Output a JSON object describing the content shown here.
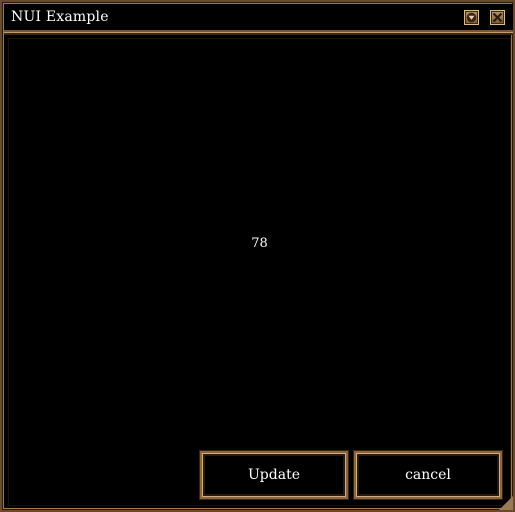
{
  "window": {
    "title": "NUI  Example"
  },
  "titlebar": {
    "icons": [
      "collapse-icon",
      "close-icon"
    ]
  },
  "main": {
    "value": "78"
  },
  "actions": {
    "update_label": "Update",
    "cancel_label": "cancel"
  },
  "colors": {
    "frame": "#8b6642",
    "frame_highlight": "#d2ad80",
    "background": "#000000",
    "text": "#ffffff"
  }
}
